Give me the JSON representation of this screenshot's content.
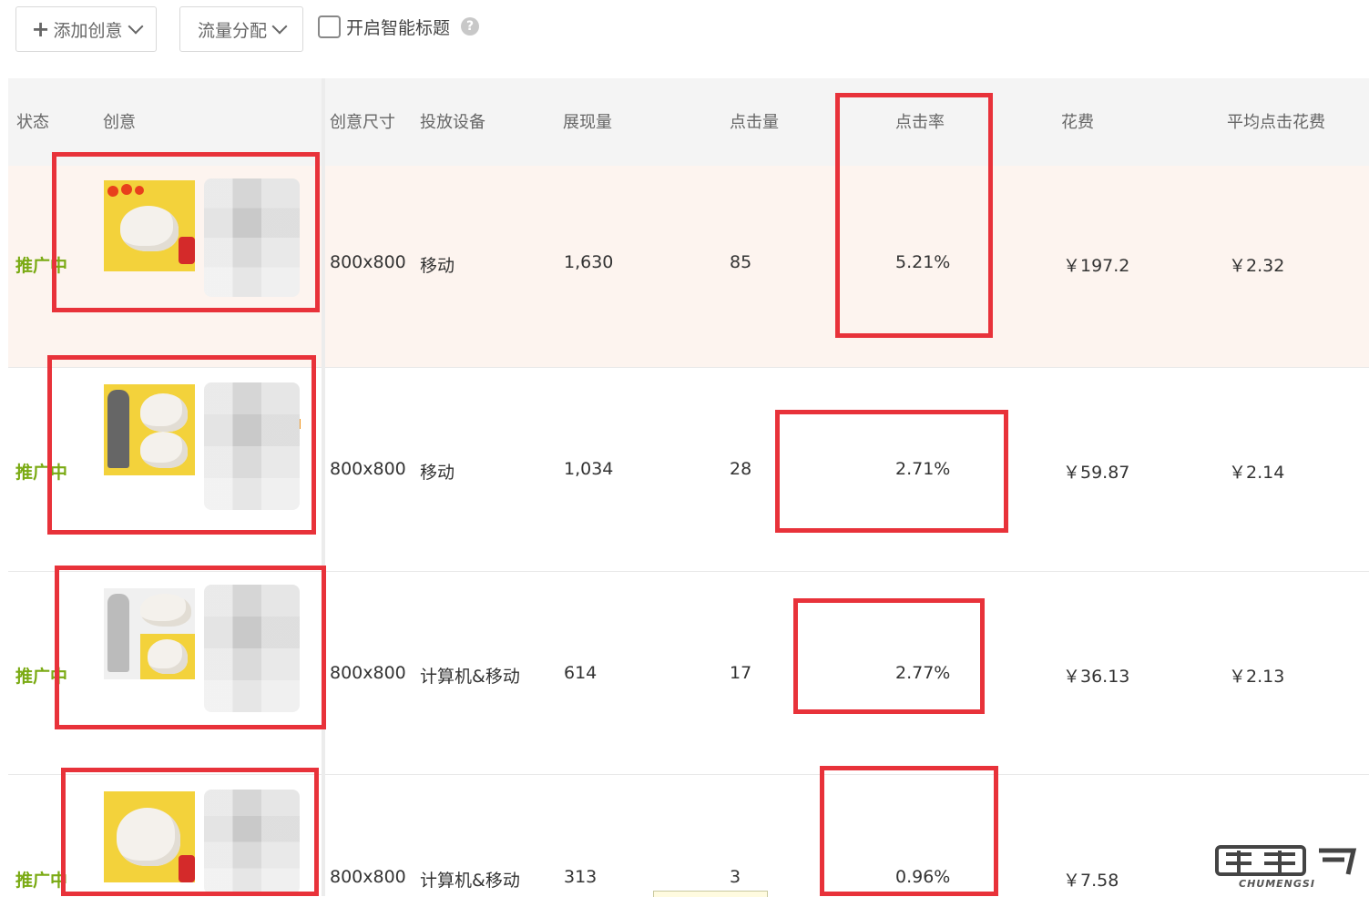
{
  "toolbar": {
    "add_creative": "添加创意",
    "traffic_split": "流量分配",
    "smart_title": "开启智能标题",
    "help": "?"
  },
  "columns": {
    "status": "状态",
    "creative": "创意",
    "size": "创意尺寸",
    "device": "投放设备",
    "impressions": "展现量",
    "clicks": "点击量",
    "ctr": "点击率",
    "cost": "花费",
    "avg_cpc": "平均点击花费"
  },
  "rows": [
    {
      "status": "推广中",
      "size": "800x800",
      "device": "移动",
      "impressions": "1,630",
      "clicks": "85",
      "ctr": "5.21%",
      "cost": "￥197.2",
      "avg_cpc": "￥2.32"
    },
    {
      "status": "推广中",
      "size": "800x800",
      "device": "移动",
      "impressions": "1,034",
      "clicks": "28",
      "ctr": "2.71%",
      "cost": "￥59.87",
      "avg_cpc": "￥2.14"
    },
    {
      "status": "推广中",
      "size": "800x800",
      "device": "计算机&移动",
      "impressions": "614",
      "clicks": "17",
      "ctr": "2.77%",
      "cost": "￥36.13",
      "avg_cpc": "￥2.13"
    },
    {
      "status": "推广中",
      "size": "800x800",
      "device": "计算机&移动",
      "impressions": "313",
      "clicks": "3",
      "ctr": "0.96%",
      "cost": "￥7.58",
      "avg_cpc": ""
    }
  ],
  "colors": {
    "status": "#7aaa13",
    "highlight_box": "#e8323a",
    "action_icon": "#f0961e",
    "row_highlight": "#fdf4ef"
  },
  "watermark": {
    "brand": "CHUMENGSI"
  },
  "icons": [
    "plus-icon",
    "chevron-down-icon",
    "help-icon",
    "edit-icon",
    "delete-icon",
    "preview-icon"
  ]
}
